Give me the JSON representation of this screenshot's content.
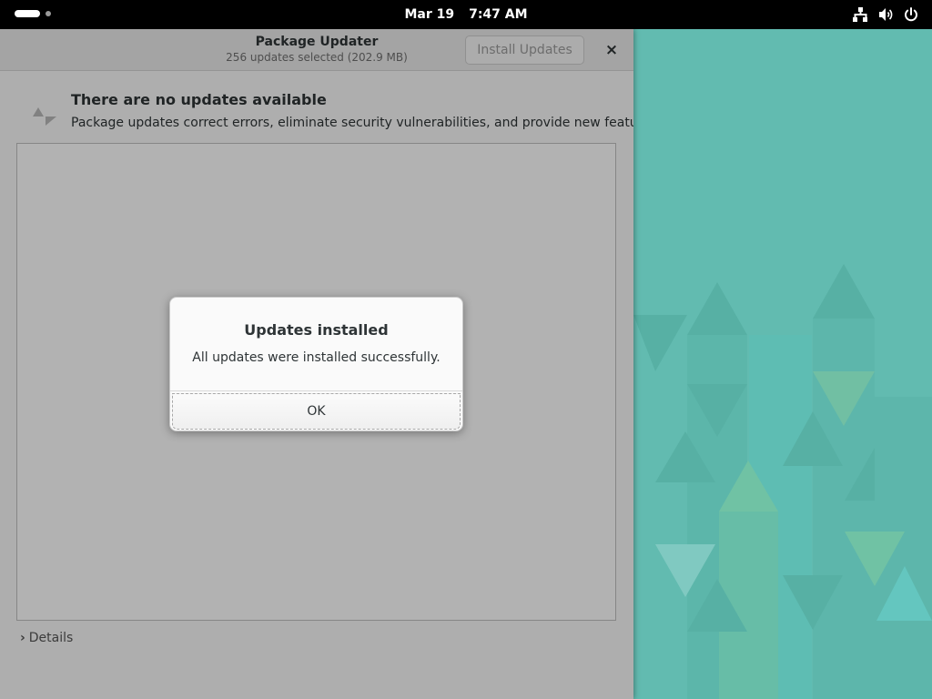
{
  "topbar": {
    "date": "Mar 19",
    "time": "7:47 AM",
    "icons": [
      "network-icon",
      "volume-icon",
      "power-icon"
    ]
  },
  "window": {
    "title": "Package Updater",
    "subtitle": "256 updates selected (202.9 MB)",
    "install_button": "Install Updates",
    "close_glyph": "×",
    "status_title": "There are no updates available",
    "status_description": "Package updates correct errors, eliminate security vulnerabilities, and provide new features.",
    "details_label": "Details",
    "details_chevron": "›"
  },
  "dialog": {
    "title": "Updates installed",
    "message": "All updates were installed successfully.",
    "ok_button": "OK"
  },
  "colors": {
    "wallpaper": "#62bbb0",
    "topbar": "#000000",
    "window_bg": "#fafafa",
    "overlay": "rgba(0,0,0,0.30)"
  }
}
